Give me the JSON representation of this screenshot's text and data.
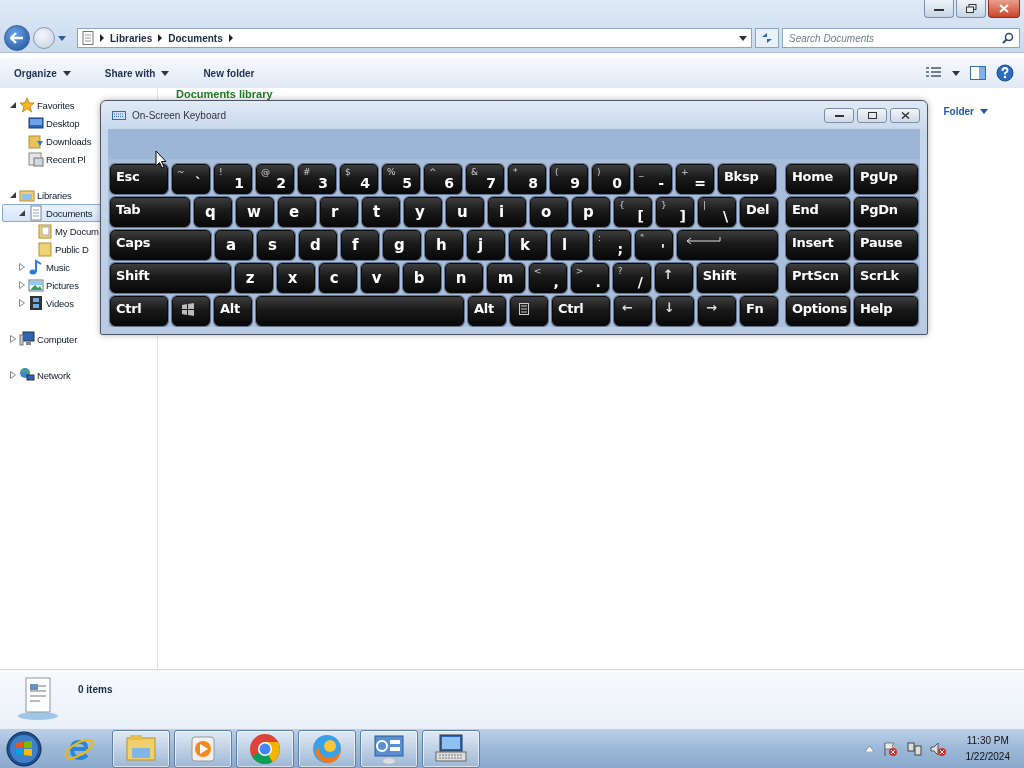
{
  "explorer": {
    "crumbs": [
      "Libraries",
      "Documents"
    ],
    "search": {
      "placeholder": "Search Documents"
    },
    "toolbar": [
      {
        "label": "Organize",
        "dropdown": true
      },
      {
        "label": "Share with",
        "dropdown": true
      },
      {
        "label": "New folder",
        "dropdown": false
      }
    ],
    "nav": [
      {
        "label": "Favorites",
        "expanded": true,
        "selected": false,
        "children": [
          {
            "label": "Desktop",
            "selected": false
          },
          {
            "label": "Downloads",
            "selected": false
          },
          {
            "label": "Recent Pl",
            "selected": false
          }
        ]
      },
      {
        "label": "Libraries",
        "expanded": true,
        "selected": false,
        "children": [
          {
            "label": "Documents",
            "expanded": true,
            "selected": true,
            "children": [
              {
                "label": "My Docum",
                "selected": false
              },
              {
                "label": "Public D",
                "selected": false
              }
            ]
          },
          {
            "label": "Music",
            "expanded": false,
            "selected": false
          },
          {
            "label": "Pictures",
            "expanded": false,
            "selected": false
          },
          {
            "label": "Videos",
            "expanded": false,
            "selected": false
          }
        ]
      },
      {
        "label": "Computer",
        "expanded": false,
        "selected": false
      },
      {
        "label": "Network",
        "expanded": false,
        "selected": false
      }
    ],
    "content": {
      "heading": "Documents library",
      "arrange": "Folder"
    },
    "details": {
      "count": "0 items"
    }
  },
  "osk": {
    "title": "On-Screen Keyboard",
    "main_rows": [
      [
        {
          "kind": "label",
          "main": "Esc"
        },
        {
          "kind": "label",
          "top": "~",
          "main": "`"
        },
        {
          "kind": "label",
          "top": "!",
          "main": "1"
        },
        {
          "kind": "label",
          "top": "@",
          "main": "2"
        },
        {
          "kind": "label",
          "top": "#",
          "main": "3"
        },
        {
          "kind": "label",
          "top": "$",
          "main": "4"
        },
        {
          "kind": "label",
          "top": "%",
          "main": "5"
        },
        {
          "kind": "label",
          "top": "^",
          "main": "6"
        },
        {
          "kind": "label",
          "top": "&",
          "main": "7"
        },
        {
          "kind": "label",
          "top": "*",
          "main": "8"
        },
        {
          "kind": "label",
          "top": "(",
          "main": "9"
        },
        {
          "kind": "label",
          "top": ")",
          "main": "0"
        },
        {
          "kind": "label",
          "top": "_",
          "main": "-"
        },
        {
          "kind": "label",
          "top": "+",
          "main": "="
        },
        {
          "kind": "label",
          "main": "Bksp"
        }
      ],
      [
        {
          "kind": "label",
          "main": "Tab"
        },
        {
          "kind": "label",
          "main": "q"
        },
        {
          "kind": "label",
          "main": "w"
        },
        {
          "kind": "label",
          "main": "e"
        },
        {
          "kind": "label",
          "main": "r"
        },
        {
          "kind": "label",
          "main": "t"
        },
        {
          "kind": "label",
          "main": "y"
        },
        {
          "kind": "label",
          "main": "u"
        },
        {
          "kind": "label",
          "main": "i"
        },
        {
          "kind": "label",
          "main": "o"
        },
        {
          "kind": "label",
          "main": "p"
        },
        {
          "kind": "label",
          "top": "{",
          "main": "["
        },
        {
          "kind": "label",
          "top": "}",
          "main": "]"
        },
        {
          "kind": "label",
          "top": "|",
          "main": "\\"
        },
        {
          "kind": "label",
          "main": "Del"
        }
      ],
      [
        {
          "kind": "label",
          "main": "Caps"
        },
        {
          "kind": "label",
          "main": "a"
        },
        {
          "kind": "label",
          "main": "s"
        },
        {
          "kind": "label",
          "main": "d"
        },
        {
          "kind": "label",
          "main": "f"
        },
        {
          "kind": "label",
          "main": "g"
        },
        {
          "kind": "label",
          "main": "h"
        },
        {
          "kind": "label",
          "main": "j"
        },
        {
          "kind": "label",
          "main": "k"
        },
        {
          "kind": "label",
          "main": "l"
        },
        {
          "kind": "label",
          "top": ":",
          "main": ";"
        },
        {
          "kind": "label",
          "top": "\"",
          "main": "'"
        },
        {
          "kind": "enter"
        }
      ],
      [
        {
          "kind": "label",
          "main": "Shift"
        },
        {
          "kind": "label",
          "main": "z"
        },
        {
          "kind": "label",
          "main": "x"
        },
        {
          "kind": "label",
          "main": "c"
        },
        {
          "kind": "label",
          "main": "v"
        },
        {
          "kind": "label",
          "main": "b"
        },
        {
          "kind": "label",
          "main": "n"
        },
        {
          "kind": "label",
          "main": "m"
        },
        {
          "kind": "label",
          "top": "<",
          "main": ","
        },
        {
          "kind": "label",
          "top": ">",
          "main": "."
        },
        {
          "kind": "label",
          "top": "?",
          "main": "/"
        },
        {
          "kind": "label",
          "top": "↑"
        },
        {
          "kind": "label",
          "main": "Shift"
        }
      ],
      [
        {
          "kind": "label",
          "main": "Ctrl"
        },
        {
          "kind": "windows"
        },
        {
          "kind": "label",
          "main": "Alt"
        },
        {
          "kind": "space"
        },
        {
          "kind": "label",
          "main": "Alt"
        },
        {
          "kind": "menu"
        },
        {
          "kind": "label",
          "main": "Ctrl"
        },
        {
          "kind": "label",
          "top": "←"
        },
        {
          "kind": "label",
          "top": "↓"
        },
        {
          "kind": "label",
          "top": "→"
        },
        {
          "kind": "label",
          "main": "Fn"
        }
      ]
    ],
    "nav_rows": [
      [
        {
          "kind": "label",
          "main": "Home"
        },
        {
          "kind": "label",
          "main": "PgUp"
        }
      ],
      [
        {
          "kind": "label",
          "main": "End"
        },
        {
          "kind": "label",
          "main": "PgDn"
        }
      ],
      [
        {
          "kind": "label",
          "main": "Insert"
        },
        {
          "kind": "label",
          "main": "Pause"
        }
      ],
      [
        {
          "kind": "label",
          "main": "PrtScn"
        },
        {
          "kind": "label",
          "main": "ScrLk"
        }
      ],
      [
        {
          "kind": "label",
          "main": "Options"
        },
        {
          "kind": "label",
          "main": "Help"
        }
      ]
    ]
  },
  "taskbar": {
    "apps": [
      {
        "running": false
      },
      {
        "running": true
      },
      {
        "running": true
      },
      {
        "running": true
      },
      {
        "running": true
      },
      {
        "running": true
      },
      {
        "running": true
      }
    ],
    "clock": {
      "time": "11:30 PM",
      "date": "1/22/2024"
    }
  }
}
